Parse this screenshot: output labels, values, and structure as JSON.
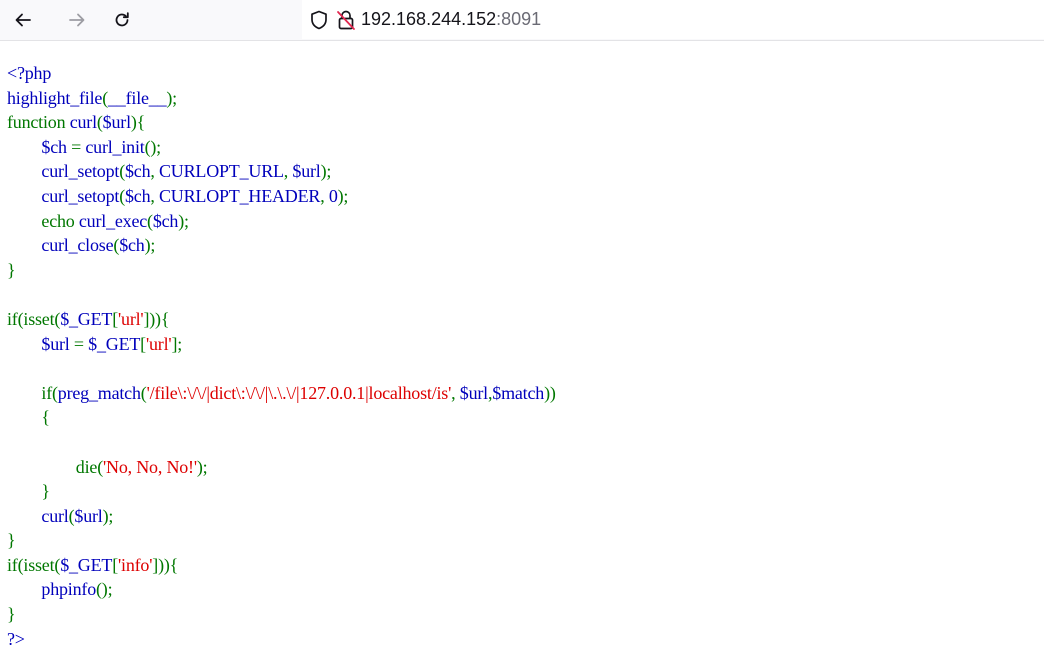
{
  "browser": {
    "url_host": "192.168.244.152",
    "url_port": ":8091",
    "icons": {
      "back": "arrow-left-icon",
      "forward": "arrow-right-icon",
      "reload": "reload-icon",
      "shield": "shield-icon",
      "insecure": "insecure-lock-icon"
    }
  },
  "colors": {
    "default": "#0000BB",
    "keyword": "#007700",
    "string": "#DD0000",
    "html": "#000000"
  },
  "code_lines": [
    [
      [
        "d",
        "<?php"
      ]
    ],
    [
      [
        "d",
        "highlight_file"
      ],
      [
        "k",
        "("
      ],
      [
        "d",
        "__file__"
      ],
      [
        "k",
        ");"
      ]
    ],
    [
      [
        "k",
        "function "
      ],
      [
        "d",
        "curl"
      ],
      [
        "k",
        "("
      ],
      [
        "d",
        "$url"
      ],
      [
        "k",
        "){"
      ]
    ],
    [
      [
        "k",
        "        "
      ],
      [
        "d",
        "$ch "
      ],
      [
        "k",
        "= "
      ],
      [
        "d",
        "curl_init"
      ],
      [
        "k",
        "();"
      ]
    ],
    [
      [
        "k",
        "        "
      ],
      [
        "d",
        "curl_setopt"
      ],
      [
        "k",
        "("
      ],
      [
        "d",
        "$ch"
      ],
      [
        "k",
        ", "
      ],
      [
        "d",
        "CURLOPT_URL"
      ],
      [
        "k",
        ", "
      ],
      [
        "d",
        "$url"
      ],
      [
        "k",
        ");"
      ]
    ],
    [
      [
        "k",
        "        "
      ],
      [
        "d",
        "curl_setopt"
      ],
      [
        "k",
        "("
      ],
      [
        "d",
        "$ch"
      ],
      [
        "k",
        ", "
      ],
      [
        "d",
        "CURLOPT_HEADER"
      ],
      [
        "k",
        ", "
      ],
      [
        "d",
        "0"
      ],
      [
        "k",
        ");"
      ]
    ],
    [
      [
        "k",
        "        echo "
      ],
      [
        "d",
        "curl_exec"
      ],
      [
        "k",
        "("
      ],
      [
        "d",
        "$ch"
      ],
      [
        "k",
        ");"
      ]
    ],
    [
      [
        "k",
        "        "
      ],
      [
        "d",
        "curl_close"
      ],
      [
        "k",
        "("
      ],
      [
        "d",
        "$ch"
      ],
      [
        "k",
        ");"
      ]
    ],
    [
      [
        "k",
        "}"
      ]
    ],
    [
      [
        "k",
        ""
      ]
    ],
    [
      [
        "k",
        "if(isset("
      ],
      [
        "d",
        "$_GET"
      ],
      [
        "k",
        "["
      ],
      [
        "s",
        "'url'"
      ],
      [
        "k",
        "])){"
      ]
    ],
    [
      [
        "k",
        "        "
      ],
      [
        "d",
        "$url "
      ],
      [
        "k",
        "= "
      ],
      [
        "d",
        "$_GET"
      ],
      [
        "k",
        "["
      ],
      [
        "s",
        "'url'"
      ],
      [
        "k",
        "];"
      ]
    ],
    [
      [
        "k",
        ""
      ]
    ],
    [
      [
        "k",
        "        if("
      ],
      [
        "d",
        "preg_match"
      ],
      [
        "k",
        "("
      ],
      [
        "s",
        "'/file\\:\\/\\/|dict\\:\\/\\/|\\.\\.\\/|127.0.0.1|localhost/is'"
      ],
      [
        "k",
        ", "
      ],
      [
        "d",
        "$url"
      ],
      [
        "k",
        ","
      ],
      [
        "d",
        "$match"
      ],
      [
        "k",
        "))"
      ]
    ],
    [
      [
        "k",
        "        {"
      ]
    ],
    [
      [
        "k",
        ""
      ]
    ],
    [
      [
        "k",
        "                die("
      ],
      [
        "s",
        "'No, No, No!'"
      ],
      [
        "k",
        ");"
      ]
    ],
    [
      [
        "k",
        "        }"
      ]
    ],
    [
      [
        "k",
        "        "
      ],
      [
        "d",
        "curl"
      ],
      [
        "k",
        "("
      ],
      [
        "d",
        "$url"
      ],
      [
        "k",
        ");"
      ]
    ],
    [
      [
        "k",
        "}"
      ]
    ],
    [
      [
        "k",
        "if(isset("
      ],
      [
        "d",
        "$_GET"
      ],
      [
        "k",
        "["
      ],
      [
        "s",
        "'info'"
      ],
      [
        "k",
        "])){"
      ]
    ],
    [
      [
        "k",
        "        "
      ],
      [
        "d",
        "phpinfo"
      ],
      [
        "k",
        "();"
      ]
    ],
    [
      [
        "k",
        "}"
      ]
    ],
    [
      [
        "d",
        "?>"
      ]
    ]
  ]
}
